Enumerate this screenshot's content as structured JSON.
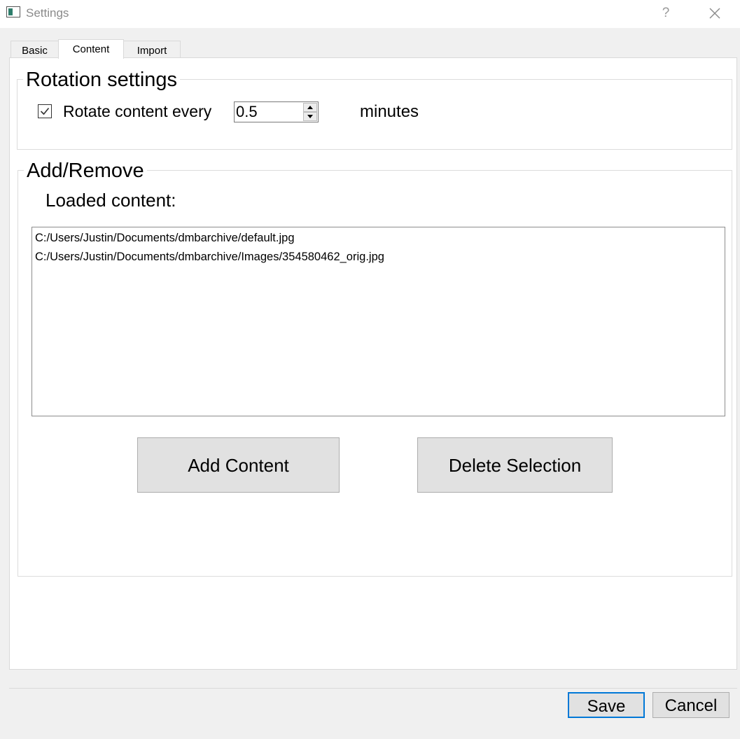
{
  "window": {
    "title": "Settings",
    "help_glyph": "?",
    "app_icon": "window-app-icon",
    "close_icon": "close-x-icon"
  },
  "tabs": [
    {
      "label": "Basic",
      "active": false
    },
    {
      "label": "Content",
      "active": true
    },
    {
      "label": "Import",
      "active": false
    }
  ],
  "rotation": {
    "group_title": "Rotation settings",
    "checkbox_checked": true,
    "checkbox_label": "Rotate content every",
    "interval_value": "0.5",
    "unit_label": "minutes"
  },
  "add_remove": {
    "group_title": "Add/Remove",
    "list_label": "Loaded content:",
    "items": [
      "C:/Users/Justin/Documents/dmbarchive/default.jpg",
      "C:/Users/Justin/Documents/dmbarchive/Images/354580462_orig.jpg"
    ],
    "add_button": "Add Content",
    "delete_button": "Delete Selection"
  },
  "footer": {
    "save_button": "Save",
    "cancel_button": "Cancel"
  },
  "colors": {
    "accent_border": "#0078d7",
    "app_icon_fill": "#2e7d6b"
  }
}
